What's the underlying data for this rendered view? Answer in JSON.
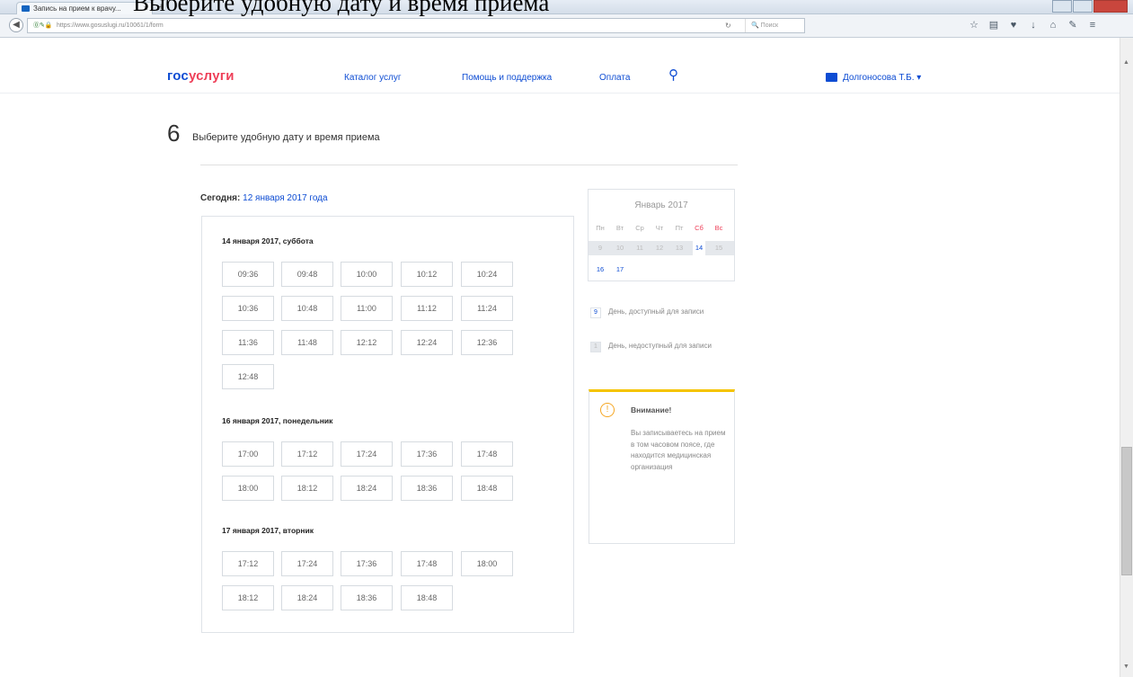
{
  "overlay_heading": "Выберите удобную дату и время приема",
  "browser": {
    "tab_title": "Запись на прием к врачу...",
    "tab_close": "×",
    "new_tab": "+",
    "url": "https://www.gosuslugi.ru/10061/1/form",
    "search_placeholder": "Поиск"
  },
  "header": {
    "logo_part1": "гос",
    "logo_part2": "услуги",
    "nav": [
      "Каталог услуг",
      "Помощь и поддержка",
      "Оплата"
    ],
    "user_name": "Долгоносова Т.Б."
  },
  "step": {
    "number": "6",
    "title": "Выберите удобную дату и время приема"
  },
  "today": {
    "label": "Сегодня:",
    "date": "12 января 2017 года"
  },
  "days": [
    {
      "title": "14 января 2017, суббота",
      "slots": [
        "09:36",
        "09:48",
        "10:00",
        "10:12",
        "10:24",
        "10:36",
        "10:48",
        "11:00",
        "11:12",
        "11:24",
        "11:36",
        "11:48",
        "12:12",
        "12:24",
        "12:36",
        "12:48"
      ]
    },
    {
      "title": "16 января 2017, понедельник",
      "slots": [
        "17:00",
        "17:12",
        "17:24",
        "17:36",
        "17:48",
        "18:00",
        "18:12",
        "18:24",
        "18:36",
        "18:48"
      ]
    },
    {
      "title": "17 января 2017, вторник",
      "slots": [
        "17:12",
        "17:24",
        "17:36",
        "17:48",
        "18:00",
        "18:12",
        "18:24",
        "18:36",
        "18:48"
      ]
    }
  ],
  "calendar": {
    "title": "Январь 2017",
    "weekdays": [
      "Пн",
      "Вт",
      "Ср",
      "Чт",
      "Пт",
      "Сб",
      "Вс"
    ],
    "row1": [
      "9",
      "10",
      "11",
      "12",
      "13",
      "14",
      "15"
    ],
    "row1_available": [
      false,
      false,
      false,
      false,
      false,
      true,
      false
    ],
    "row2": [
      "16",
      "17"
    ]
  },
  "legend": {
    "available": "День, доступный для записи",
    "unavailable": "День, недоступный для записи",
    "available_sample": "9",
    "unavailable_sample": "1"
  },
  "attention": {
    "title": "Внимание!",
    "text": "Вы записываетесь на прием в том часовом поясе, где находится медицинская организация"
  },
  "colors": {
    "accent": "#0d4cd3",
    "logo_red": "#ee3f58",
    "warning": "#f5c400"
  }
}
